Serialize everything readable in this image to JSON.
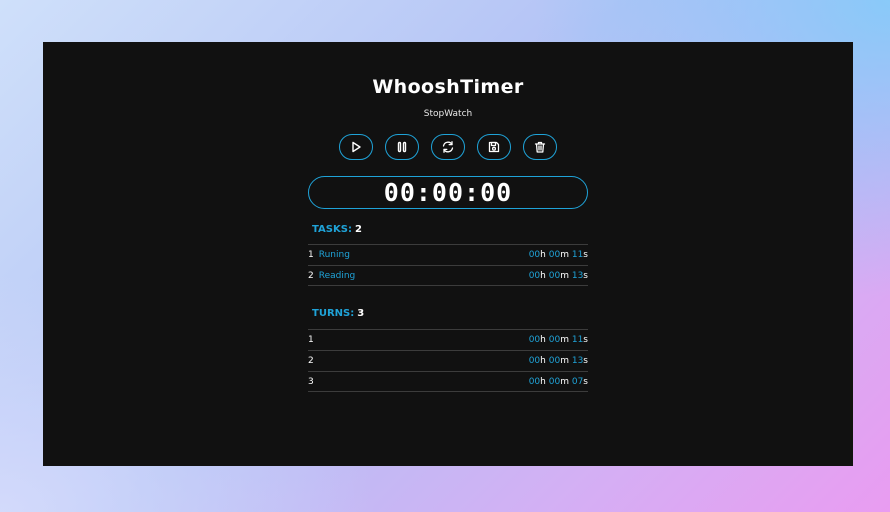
{
  "app": {
    "title": "WhooshTimer",
    "subtitle": "StopWatch"
  },
  "controls": [
    {
      "name": "play",
      "icon": "play-icon"
    },
    {
      "name": "pause",
      "icon": "pause-icon"
    },
    {
      "name": "reset",
      "icon": "refresh-icon"
    },
    {
      "name": "save",
      "icon": "floppy-disk-icon"
    },
    {
      "name": "delete",
      "icon": "trash-icon"
    }
  ],
  "display": {
    "time": "00:00:00"
  },
  "tasks": {
    "label": "TASKS:",
    "count": "2",
    "items": [
      {
        "index": "1",
        "name": "Runing",
        "h": "00",
        "m": "00",
        "s": "11"
      },
      {
        "index": "2",
        "name": "Reading",
        "h": "00",
        "m": "00",
        "s": "13"
      }
    ]
  },
  "turns": {
    "label": "TURNS:",
    "count": "3",
    "items": [
      {
        "index": "1",
        "h": "00",
        "m": "00",
        "s": "11"
      },
      {
        "index": "2",
        "h": "00",
        "m": "00",
        "s": "13"
      },
      {
        "index": "3",
        "h": "00",
        "m": "00",
        "s": "07"
      }
    ]
  },
  "units": {
    "h": "h",
    "m": "m",
    "s": "s"
  },
  "colors": {
    "accent": "#1fa3d8",
    "panel": "#111111",
    "text": "#ffffff"
  }
}
